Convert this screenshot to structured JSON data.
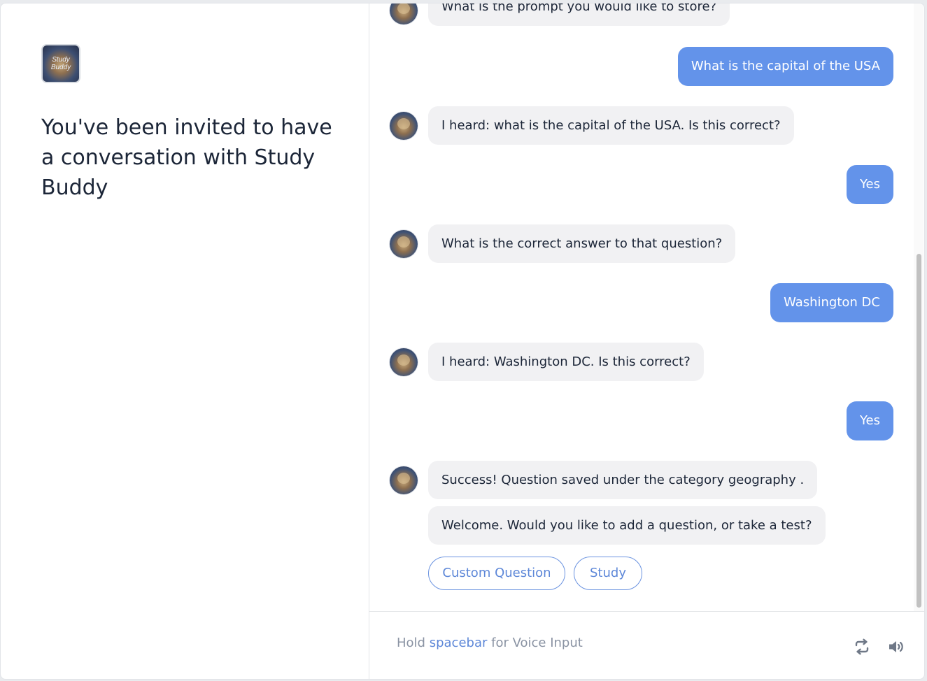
{
  "left_panel": {
    "logo_text": "Study Buddy",
    "invite_text": "You've been invited to have a conversation with Study Buddy"
  },
  "chat": {
    "messages": [
      {
        "role": "bot",
        "text": "What is the prompt you would like to store?"
      },
      {
        "role": "user",
        "text": "What is the capital of the USA"
      },
      {
        "role": "bot",
        "text": "I heard: what is the capital of the USA. Is this correct?"
      },
      {
        "role": "user",
        "text": "Yes"
      },
      {
        "role": "bot",
        "text": "What is the correct answer to that question?"
      },
      {
        "role": "user",
        "text": "Washington DC"
      },
      {
        "role": "bot",
        "text": "I heard: Washington DC. Is this correct?"
      },
      {
        "role": "user",
        "text": "Yes"
      },
      {
        "role": "bot",
        "text": "Success! Question saved under the category geography ."
      },
      {
        "role": "bot",
        "text": "Welcome. Would you like to add a question, or take a test?"
      }
    ],
    "quick_replies": [
      "Custom Question",
      "Study"
    ]
  },
  "input_bar": {
    "hint_prefix": "Hold",
    "hint_key": "spacebar",
    "hint_suffix": "for Voice Input",
    "icons": [
      "repeat-icon",
      "speaker-icon"
    ]
  },
  "colors": {
    "user_bubble": "#6393ea",
    "bot_bubble": "#f1f1f3",
    "accent": "#5d87d8",
    "text": "#1c2638"
  }
}
